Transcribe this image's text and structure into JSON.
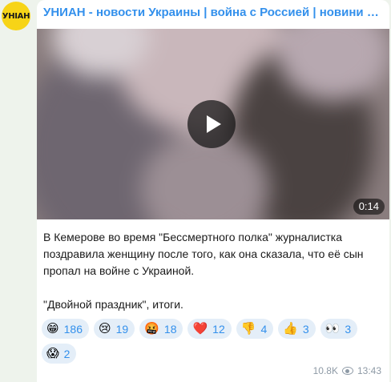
{
  "channel": {
    "name": "УНИАН - новости Украины | война с Россией | новини України",
    "avatar_text": "УНІАН",
    "avatar_color": "#f7d417"
  },
  "video": {
    "duration": "0:14",
    "play_icon": "play-icon"
  },
  "message": {
    "paragraphs": [
      "В Кемерове во время \"Бессмертного полка\" журналистка поздравила женщину после того, как она сказала, что её сын пропал на войне с Украиной.",
      "\"Двойной праздник\", итоги."
    ]
  },
  "reactions": [
    {
      "emoji": "😁",
      "count": "186"
    },
    {
      "emoji": "😢",
      "count": "19"
    },
    {
      "emoji": "🤬",
      "count": "18"
    },
    {
      "emoji": "❤️",
      "count": "12"
    },
    {
      "emoji": "👎",
      "count": "4"
    },
    {
      "emoji": "👍",
      "count": "3"
    },
    {
      "emoji": "👀",
      "count": "3"
    },
    {
      "emoji": "😱",
      "count": "2"
    }
  ],
  "meta": {
    "views": "10.8K",
    "time": "13:43",
    "views_icon": "eye-icon"
  },
  "colors": {
    "accent": "#3390ec",
    "background": "#eef3ec",
    "reaction_bg": "#e4eef8"
  }
}
